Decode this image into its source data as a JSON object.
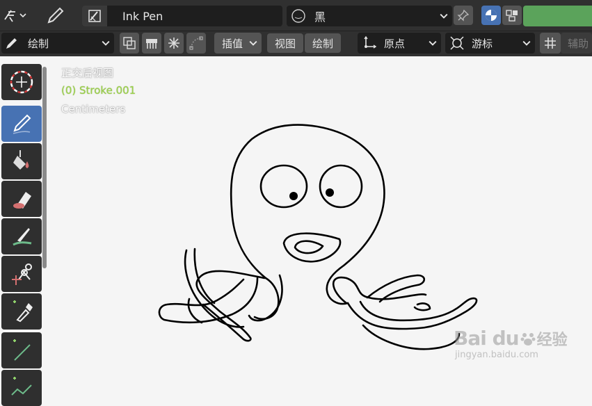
{
  "header": {
    "brush_name": "Ink Pen",
    "material_name": "黑"
  },
  "toolbar2": {
    "mode_label": "绘制",
    "interpolate_label": "插值",
    "view_label": "视图",
    "draw_label": "绘制",
    "origin_label": "原点",
    "cursor_label": "游标",
    "guides_label": "辅助"
  },
  "viewport": {
    "view_name": "正交后视图",
    "object_info": "(0) Stroke.001",
    "units": "Centimeters"
  },
  "watermark": {
    "brand": "Bai du",
    "brand_suffix": "经验",
    "url": "jingyan.baidu.com"
  },
  "colors": {
    "accent": "#4772b3",
    "object_info": "#9bd14b",
    "layer_green": "#5ba35b",
    "panel_bg": "#303030",
    "widget_bg": "#1e1e1e"
  },
  "icons": {
    "tools": [
      "cursor-icon",
      "draw-icon",
      "fill-icon",
      "erase-icon",
      "tint-icon",
      "cutter-icon",
      "eyedropper-icon",
      "line-icon",
      "polyline-icon"
    ]
  }
}
